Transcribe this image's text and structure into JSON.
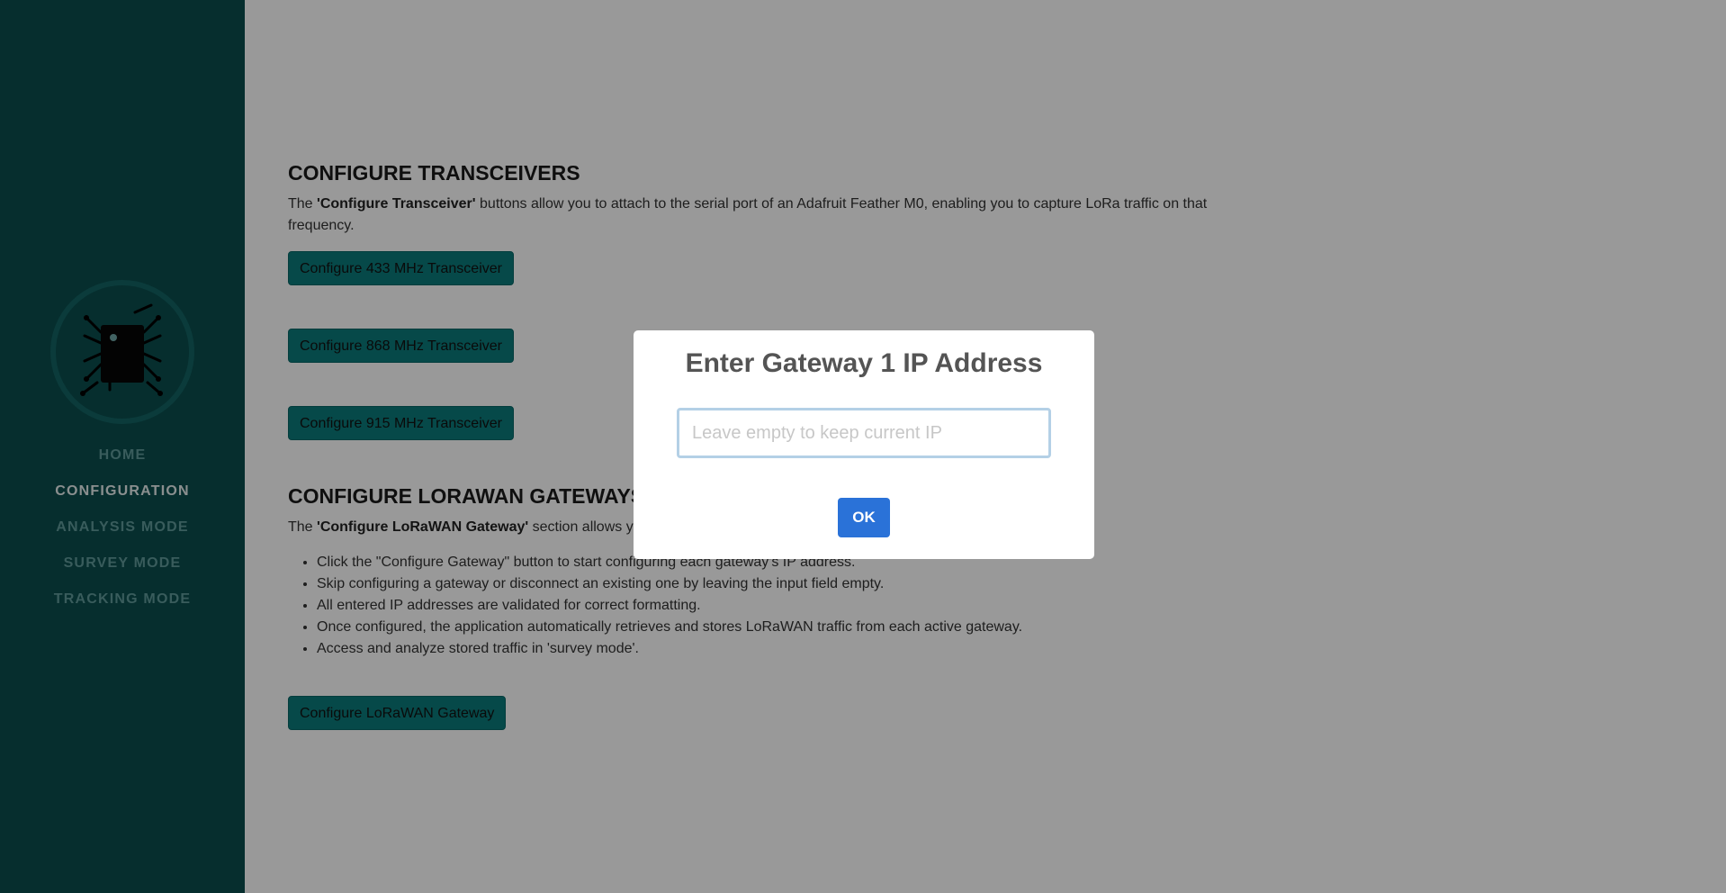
{
  "sidebar": {
    "logo": "chip-logo",
    "nav": [
      {
        "label": "HOME",
        "active": false
      },
      {
        "label": "CONFIGURATION",
        "active": true
      },
      {
        "label": "ANALYSIS MODE",
        "active": false
      },
      {
        "label": "SURVEY MODE",
        "active": false
      },
      {
        "label": "TRACKING MODE",
        "active": false
      }
    ]
  },
  "transceivers": {
    "title": "CONFIGURE TRANSCEIVERS",
    "desc_pre": "The ",
    "desc_bold": "'Configure Transceiver'",
    "desc_post": " buttons allow you to attach to the serial port of an Adafruit Feather M0, enabling you to capture LoRa traffic on that frequency.",
    "buttons": [
      "Configure 433 MHz Transceiver",
      "Configure 868 MHz Transceiver",
      "Configure 915 MHz Transceiver"
    ]
  },
  "gateways": {
    "title": "CONFIGURE LORAWAN GATEWAYS",
    "desc_pre": "The ",
    "desc_bold": "'Configure LoRaWAN Gateway'",
    "desc_post": " section allows you to configure up to three gateways.",
    "bullets": [
      "Click the \"Configure Gateway\" button to start configuring each gateway's IP address.",
      "Skip configuring a gateway or disconnect an existing one by leaving the input field empty.",
      "All entered IP addresses are validated for correct formatting.",
      "Once configured, the application automatically retrieves and stores LoRaWAN traffic from each active gateway.",
      "Access and analyze stored traffic in 'survey mode'."
    ],
    "button": "Configure LoRaWAN Gateway"
  },
  "modal": {
    "title": "Enter Gateway 1 IP Address",
    "input_value": "",
    "input_placeholder": "Leave empty to keep current IP",
    "ok_label": "OK"
  },
  "colors": {
    "sidebar_bg": "#0a4d4d",
    "button_teal": "#0a7a7a",
    "ok_blue": "#2a72d8",
    "nav_inactive": "#5f9a9a",
    "nav_active": "#e6efef"
  }
}
